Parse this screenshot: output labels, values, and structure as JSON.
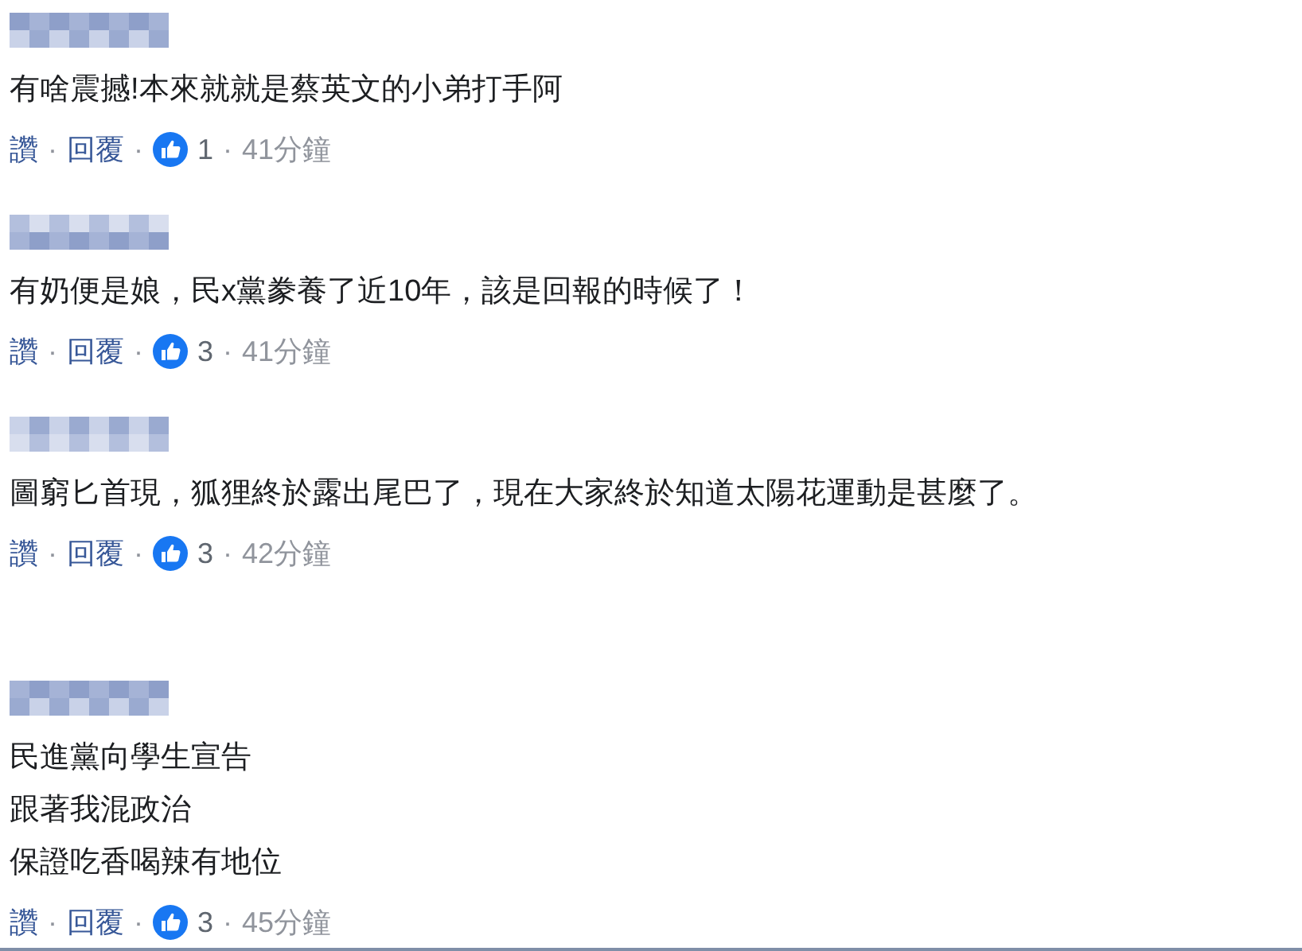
{
  "comments": [
    {
      "lines": [
        "有啥震撼!本來就就是蔡英文的小弟打手阿"
      ],
      "like": "讚",
      "reply": "回覆",
      "reactions": "1",
      "time": "41分鐘",
      "separators": [
        "·",
        "·",
        "·"
      ]
    },
    {
      "lines": [
        "有奶便是娘，民x黨豢養了近10年，該是回報的時候了！"
      ],
      "like": "讚",
      "reply": "回覆",
      "reactions": "3",
      "time": "41分鐘",
      "separators": [
        "·",
        "·",
        "·"
      ]
    },
    {
      "lines": [
        "圖窮匕首現，狐狸終於露出尾巴了，現在大家終於知道太陽花運動是甚麼了。"
      ],
      "like": "讚",
      "reply": "回覆",
      "reactions": "3",
      "time": "42分鐘",
      "separators": [
        "·",
        "·",
        "·"
      ]
    },
    {
      "lines": [
        "民進黨向學生宣告",
        "跟著我混政治",
        "保證吃香喝辣有地位"
      ],
      "like": "讚",
      "reply": "回覆",
      "reactions": "3",
      "time": "45分鐘",
      "separators": [
        "·",
        "·",
        "·"
      ]
    }
  ]
}
